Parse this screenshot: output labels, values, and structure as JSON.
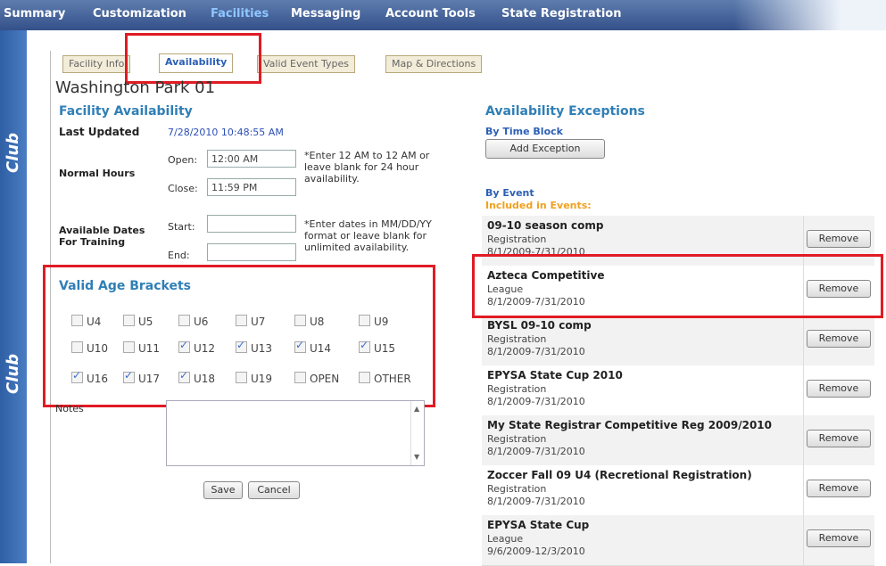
{
  "nav": {
    "items": [
      "Summary",
      "Customization",
      "Facilities",
      "Messaging",
      "Account Tools",
      "State Registration"
    ],
    "active_index": 2
  },
  "sidebar": {
    "label_top": "Club",
    "label_bottom": "Club"
  },
  "tabs": [
    "Facility Info",
    "Availability",
    "Valid Event Types",
    "Map & Directions"
  ],
  "active_tab_index": 1,
  "facility_name": "Washington Park 01",
  "availability": {
    "section_title": "Facility Availability",
    "last_updated_label": "Last Updated",
    "last_updated_value": "7/28/2010 10:48:55 AM",
    "normal_hours_label": "Normal Hours",
    "open_label": "Open:",
    "open_value": "12:00 AM",
    "close_label": "Close:",
    "close_value": "11:59 PM",
    "hours_hint": "*Enter 12 AM to 12 AM or leave blank for 24 hour availability.",
    "available_dates_label": "Available Dates For Training",
    "start_label": "Start:",
    "start_value": "",
    "end_label": "End:",
    "end_value": "",
    "dates_hint": "*Enter dates in MM/DD/YY format or leave blank for unlimited availability."
  },
  "age_brackets": {
    "title": "Valid Age Brackets",
    "items": [
      {
        "label": "U4",
        "checked": false
      },
      {
        "label": "U5",
        "checked": false
      },
      {
        "label": "U6",
        "checked": false
      },
      {
        "label": "U7",
        "checked": false
      },
      {
        "label": "U8",
        "checked": false
      },
      {
        "label": "U9",
        "checked": false
      },
      {
        "label": "U10",
        "checked": false
      },
      {
        "label": "U11",
        "checked": false
      },
      {
        "label": "U12",
        "checked": true
      },
      {
        "label": "U13",
        "checked": true
      },
      {
        "label": "U14",
        "checked": true
      },
      {
        "label": "U15",
        "checked": true
      },
      {
        "label": "U16",
        "checked": true
      },
      {
        "label": "U17",
        "checked": true
      },
      {
        "label": "U18",
        "checked": true
      },
      {
        "label": "U19",
        "checked": false
      },
      {
        "label": "OPEN",
        "checked": false
      },
      {
        "label": "OTHER",
        "checked": false
      }
    ]
  },
  "notes_label": "Notes",
  "buttons": {
    "save": "Save",
    "cancel": "Cancel"
  },
  "exceptions": {
    "title": "Availability Exceptions",
    "by_time_block_label": "By Time Block",
    "add_exception": "Add Exception",
    "by_event_label": "By Event",
    "included_label": "Included in Events:",
    "remove_label": "Remove",
    "events": [
      {
        "name": "09-10 season comp",
        "type": "Registration",
        "dates": "8/1/2009-7/31/2010"
      },
      {
        "name": "Azteca Competitive",
        "type": "League",
        "dates": "8/1/2009-7/31/2010"
      },
      {
        "name": "BYSL 09-10 comp",
        "type": "Registration",
        "dates": "8/1/2009-7/31/2010"
      },
      {
        "name": "EPYSA State Cup 2010",
        "type": "Registration",
        "dates": "8/1/2009-7/31/2010"
      },
      {
        "name": "My State Registrar Competitive Reg 2009/2010",
        "type": "Registration",
        "dates": "8/1/2009-7/31/2010"
      },
      {
        "name": "Zoccer Fall 09 U4 (Recretional Registration)",
        "type": "Registration",
        "dates": "8/1/2009-7/31/2010"
      },
      {
        "name": "EPYSA State Cup",
        "type": "League",
        "dates": "9/6/2009-12/3/2010"
      }
    ]
  },
  "colors": {
    "highlight": "#e01b24",
    "nav_bg": "#34508a",
    "section_blue": "#2f7fb6"
  }
}
